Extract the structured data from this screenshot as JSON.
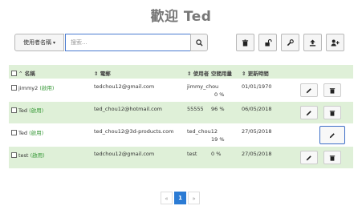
{
  "page": {
    "title": "歡迎 Ted"
  },
  "toolbar": {
    "filter_label": "使用者名稱",
    "search_placeholder": "搜索...",
    "icons": [
      "trash-icon",
      "unlock-icon",
      "wrench-icon",
      "upload-icon",
      "add-user-icon"
    ]
  },
  "table": {
    "headers": {
      "name": "名稱",
      "email": "電郵",
      "user": "使用者",
      "usage": "空間用量",
      "updated": "更新時間"
    },
    "rows": [
      {
        "name": "jimmy2",
        "status": "(啟用)",
        "email": "tedchou12@gmail.com",
        "user": "jimmy_chou",
        "usage": "0 %",
        "updated": "01/01/1970"
      },
      {
        "name": "Ted",
        "status": "(啟用)",
        "email": "ted_chou12@hotmail.com",
        "user": "55555",
        "usage": "96 %",
        "updated": "06/05/2018"
      },
      {
        "name": "Ted",
        "status": "(啟用)",
        "email": "ted_chou12@3d-products.com",
        "user": "ted_chou12",
        "usage": "19 %",
        "updated": "27/05/2018"
      },
      {
        "name": "test",
        "status": "(啟用)",
        "email": "tedchou12@gmail.com",
        "user": "test",
        "usage": "0 %",
        "updated": "27/05/2018"
      }
    ]
  },
  "pagination": {
    "prev": "«",
    "current": "1",
    "next": "»"
  },
  "colors": {
    "row_highlight": "#dff0d8",
    "active_status": "#3c9b3c",
    "accent": "#2b7bd4"
  }
}
